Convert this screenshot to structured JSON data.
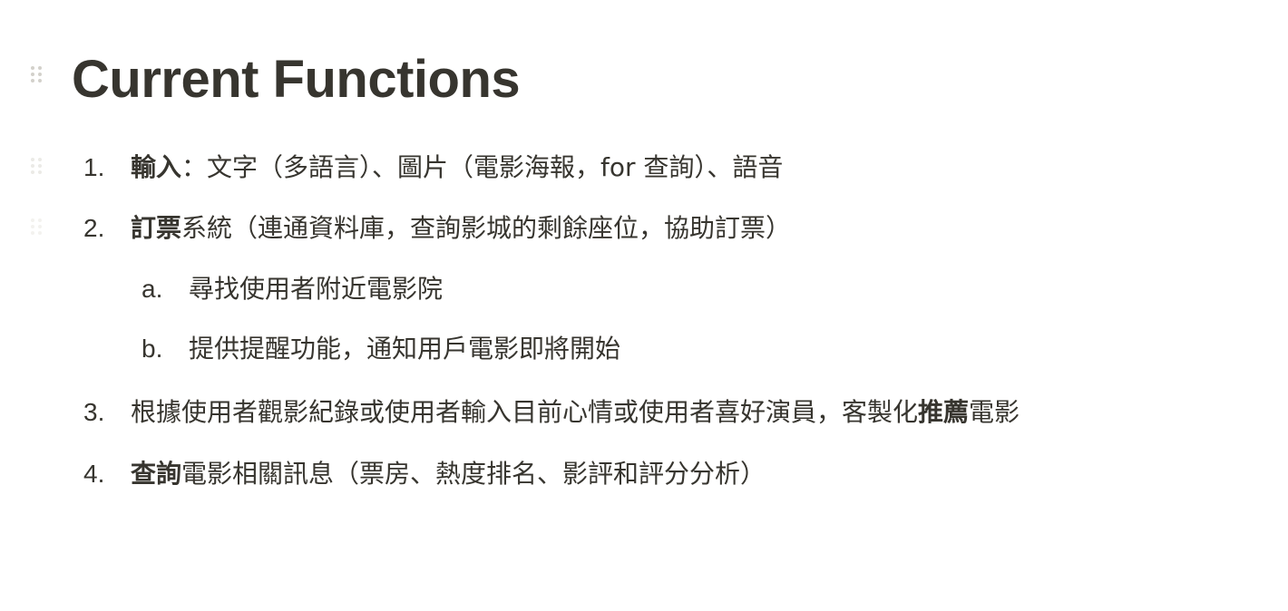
{
  "heading": "Current Functions",
  "items": [
    {
      "marker": "1.",
      "bold": "輸入",
      "rest": "：文字（多語言）、圖片（電影海報，for 查詢）、語音"
    },
    {
      "marker": "2.",
      "bold": "訂票",
      "rest": "系統（連通資料庫，查詢影城的剩餘座位，協助訂票）",
      "children": [
        {
          "marker": "a.",
          "text": "尋找使用者附近電影院"
        },
        {
          "marker": "b.",
          "text": "提供提醒功能，通知用戶電影即將開始"
        }
      ]
    },
    {
      "marker": "3.",
      "pre": "根據使用者觀影紀錄或使用者輸入目前心情或使用者喜好演員，客製化",
      "bold": "推薦",
      "post": "電影"
    },
    {
      "marker": "4.",
      "bold": "查詢",
      "rest": "電影相關訊息（票房、熱度排名、影評和評分分析）"
    }
  ],
  "icons": {
    "drag_handle": "drag-handle-icon"
  }
}
